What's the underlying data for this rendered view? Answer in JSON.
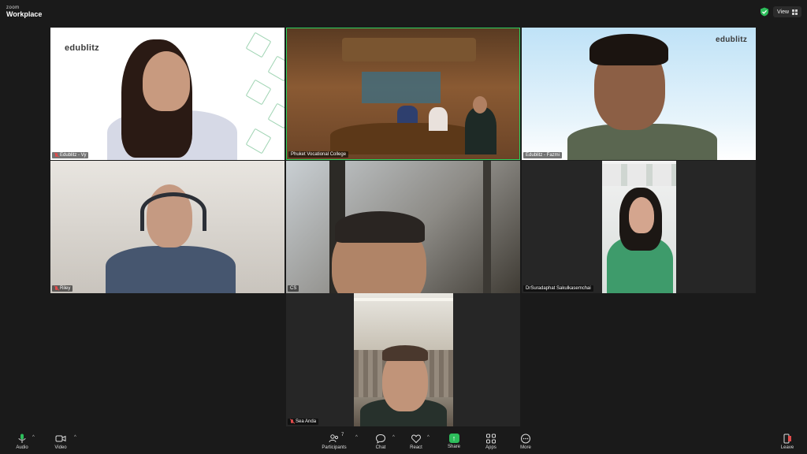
{
  "app": {
    "brand_small": "zoom",
    "brand_name": "Workplace",
    "view_label": "View"
  },
  "participants": [
    {
      "name": "Edublitz - Vy",
      "muted": true,
      "logo": "edublitz"
    },
    {
      "name": "Phuket Vocational College",
      "muted": false,
      "active_speaker": true
    },
    {
      "name": "Edublitz - Fazmi",
      "muted": false,
      "logo": "edublitz"
    },
    {
      "name": "Riley",
      "muted": true
    },
    {
      "name": "CS",
      "muted": false
    },
    {
      "name": "DrSuradaphat Sakulkasemchai",
      "muted": false
    },
    {
      "name": "Sea Anda",
      "muted": true
    }
  ],
  "toolbar": {
    "audio": "Audio",
    "video": "Video",
    "participants": "Participants",
    "participant_count": "7",
    "chat": "Chat",
    "react": "React",
    "share": "Share",
    "apps": "Apps",
    "more": "More",
    "leave": "Leave"
  },
  "colors": {
    "active_speaker_border": "#2dd35e",
    "share_green": "#2dbd5b",
    "mute_red": "#e04b4b"
  }
}
